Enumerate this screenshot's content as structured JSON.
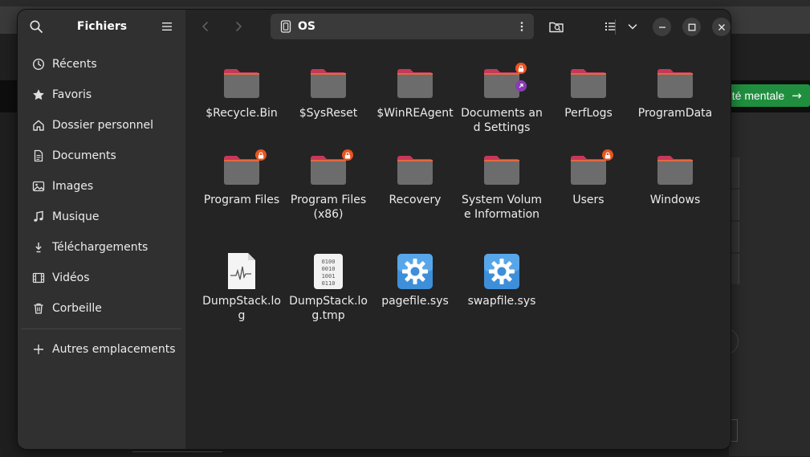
{
  "sidebar": {
    "title": "Fichiers",
    "items": [
      {
        "label": "Récents",
        "icon": "clock-icon"
      },
      {
        "label": "Favoris",
        "icon": "star-icon"
      },
      {
        "label": "Dossier personnel",
        "icon": "home-icon"
      },
      {
        "label": "Documents",
        "icon": "document-icon"
      },
      {
        "label": "Images",
        "icon": "image-icon"
      },
      {
        "label": "Musique",
        "icon": "music-icon"
      },
      {
        "label": "Téléchargements",
        "icon": "download-icon"
      },
      {
        "label": "Vidéos",
        "icon": "video-icon"
      },
      {
        "label": "Corbeille",
        "icon": "trash-icon"
      }
    ],
    "other_locations": "Autres emplacements"
  },
  "header": {
    "path": "OS"
  },
  "files": [
    {
      "name": "$Recycle.Bin",
      "type": "folder",
      "locked": false,
      "link": false
    },
    {
      "name": "$SysReset",
      "type": "folder",
      "locked": false,
      "link": false
    },
    {
      "name": "$WinREAgent",
      "type": "folder",
      "locked": false,
      "link": false
    },
    {
      "name": "Documents and Settings",
      "type": "folder",
      "locked": true,
      "link": true
    },
    {
      "name": "PerfLogs",
      "type": "folder",
      "locked": false,
      "link": false
    },
    {
      "name": "ProgramData",
      "type": "folder",
      "locked": false,
      "link": false
    },
    {
      "name": "Program Files",
      "type": "folder",
      "locked": true,
      "link": false
    },
    {
      "name": "Program Files (x86)",
      "type": "folder",
      "locked": true,
      "link": false
    },
    {
      "name": "Recovery",
      "type": "folder",
      "locked": false,
      "link": false
    },
    {
      "name": "System Volume Information",
      "type": "folder",
      "locked": false,
      "link": false
    },
    {
      "name": "Users",
      "type": "folder",
      "locked": true,
      "link": false
    },
    {
      "name": "Windows",
      "type": "folder",
      "locked": false,
      "link": false
    },
    {
      "name": "DumpStack.log",
      "type": "log",
      "locked": false,
      "link": false
    },
    {
      "name": "DumpStack.log.tmp",
      "type": "binary",
      "locked": false,
      "link": false
    },
    {
      "name": "pagefile.sys",
      "type": "system",
      "locked": false,
      "link": false
    },
    {
      "name": "swapfile.sys",
      "type": "system",
      "locked": false,
      "link": false
    }
  ],
  "background": {
    "button_label": "nté mentale"
  },
  "colors": {
    "folder_tab": "#c6385a",
    "folder_body": "#6c6c6c",
    "lock_badge": "#e95420",
    "link_badge": "#8a3bb5",
    "sidebar_bg": "#303030",
    "main_bg": "#242424"
  }
}
